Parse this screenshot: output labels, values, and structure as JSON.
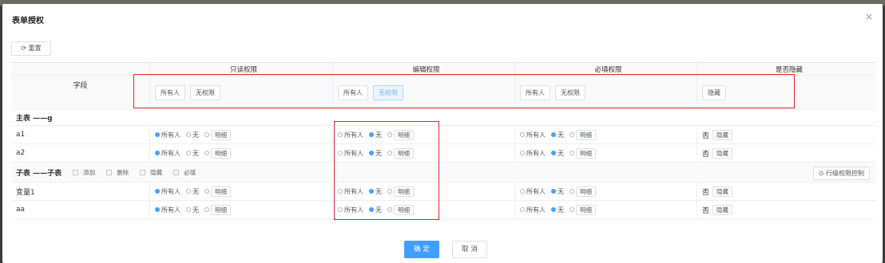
{
  "dialog": {
    "title": "表单授权",
    "close": "×"
  },
  "toolbar": {
    "reset_label": "⟳ 重置"
  },
  "columns": [
    "字段",
    "只读权限",
    "编辑权限",
    "必填权限",
    "是否隐藏"
  ],
  "header_buttons": {
    "readonly": [
      "所有人",
      "无权限"
    ],
    "edit": [
      "所有人",
      "无权限"
    ],
    "required": [
      "所有人",
      "无权限"
    ],
    "hidden": "隐藏"
  },
  "radio_labels": {
    "all": "所有人",
    "none": "无",
    "detail": "明细"
  },
  "hidden_no": "否",
  "hidden_btn": "隐藏",
  "main_group": {
    "label": "主表 ——g",
    "rows": [
      "a1",
      "a2"
    ]
  },
  "sub_group": {
    "label": "子表 ——子表",
    "checks": [
      "添加",
      "删除",
      "隐藏",
      "必填"
    ],
    "row_perm_button": "⊙ 行级权限控制",
    "rows": [
      "变量1",
      "aa"
    ]
  },
  "footer": {
    "ok": "确 定",
    "cancel": "取 消"
  },
  "colors": {
    "accent": "#409eff",
    "highlight_border": "#e0282e"
  }
}
